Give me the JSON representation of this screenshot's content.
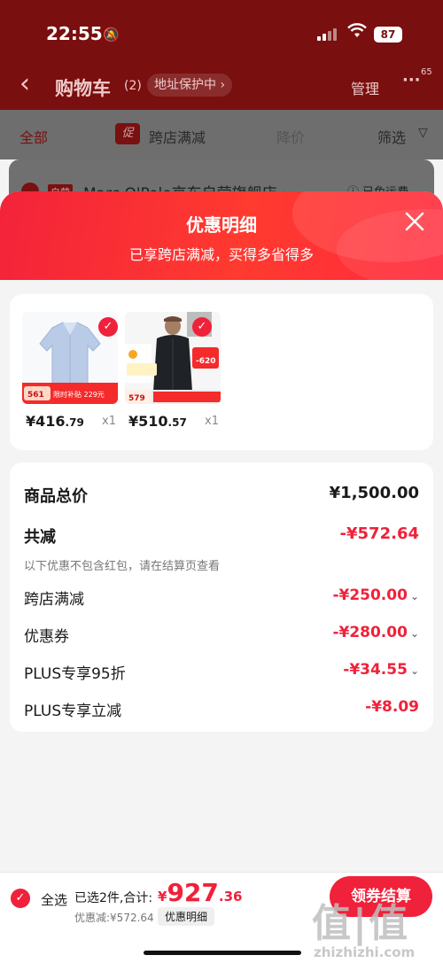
{
  "status": {
    "time": "22:55",
    "battery": "87"
  },
  "header": {
    "title": "购物车",
    "count": "(2)",
    "address_pill": "地址保护中 ›",
    "manage": "管理",
    "badge": "65"
  },
  "filters": {
    "all": "全部",
    "promo_icon": "促",
    "promo": "跨店满减",
    "price": "降价",
    "screen": "筛选"
  },
  "shop": {
    "tag": "自营",
    "name": "Marc O'Polo京东自营旗舰店 ›",
    "shipping": "ⓘ 已免运费"
  },
  "sheet": {
    "title": "优惠明细",
    "subtitle": "已享跨店满减，买得多省得多"
  },
  "products": [
    {
      "price_int": "¥416",
      "price_dec": ".79",
      "qty": "x1",
      "badge": "561",
      "promo": "限时补贴 229元"
    },
    {
      "price_int": "¥510",
      "price_dec": ".57",
      "qty": "x1",
      "badge": "579",
      "promo": "-620"
    }
  ],
  "breakdown": {
    "total_label": "商品总价",
    "total_value": "¥1,500.00",
    "discount_label": "共减",
    "discount_value": "-¥572.64",
    "note": "以下优惠不包含红包，请在结算页查看",
    "items": [
      {
        "label": "跨店满减",
        "value": "-¥250.00"
      },
      {
        "label": "优惠券",
        "value": "-¥280.00"
      },
      {
        "label": "PLUS专享95折",
        "value": "-¥34.55"
      },
      {
        "label": "PLUS专享立减",
        "value": "-¥8.09"
      }
    ]
  },
  "bottom": {
    "select_all": "全选",
    "selected_text": "已选2件,合计:",
    "sum_yen": "¥",
    "sum_int": "927",
    "sum_dec": ".36",
    "discount_text": "优惠减:¥572.64",
    "detail_pill": "优惠明细",
    "checkout": "领券结算"
  },
  "watermark": {
    "mark": "值|值",
    "url": "zhizhizhi.com"
  },
  "colors": {
    "accent": "#f0213a",
    "header_dim": "#7a0f0f"
  }
}
